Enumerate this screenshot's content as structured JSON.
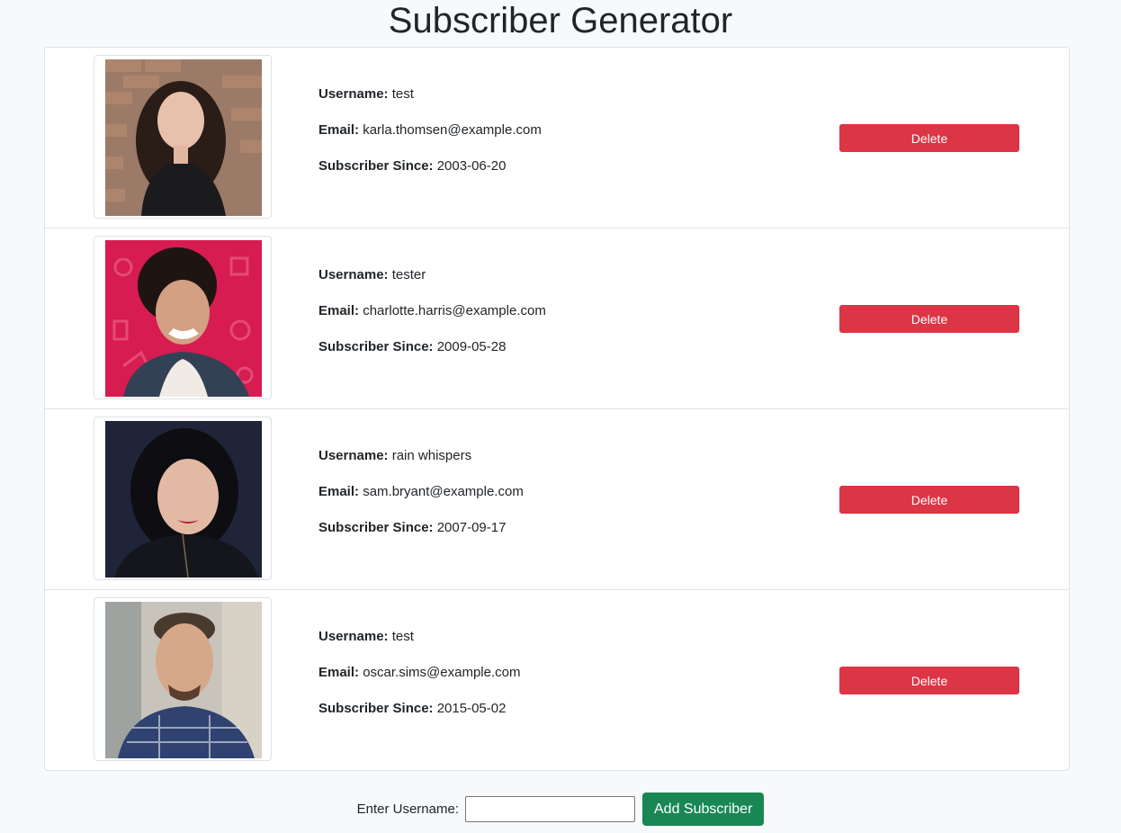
{
  "title": "Subscriber Generator",
  "labels": {
    "username": "Username:",
    "email": "Email:",
    "since": "Subscriber Since:"
  },
  "subscribers": [
    {
      "username": "test",
      "email": "karla.thomsen@example.com",
      "since": "2003-06-20",
      "delete_label": "Delete"
    },
    {
      "username": "tester",
      "email": "charlotte.harris@example.com",
      "since": "2009-05-28",
      "delete_label": "Delete"
    },
    {
      "username": "rain whispers",
      "email": "sam.bryant@example.com",
      "since": "2007-09-17",
      "delete_label": "Delete"
    },
    {
      "username": "test",
      "email": "oscar.sims@example.com",
      "since": "2015-05-02",
      "delete_label": "Delete"
    }
  ],
  "form": {
    "label": "Enter Username:",
    "input_value": "",
    "button_label": "Add Subscriber"
  },
  "colors": {
    "delete": "#dc3545",
    "add": "#198754",
    "background": "#f8f9fa"
  }
}
